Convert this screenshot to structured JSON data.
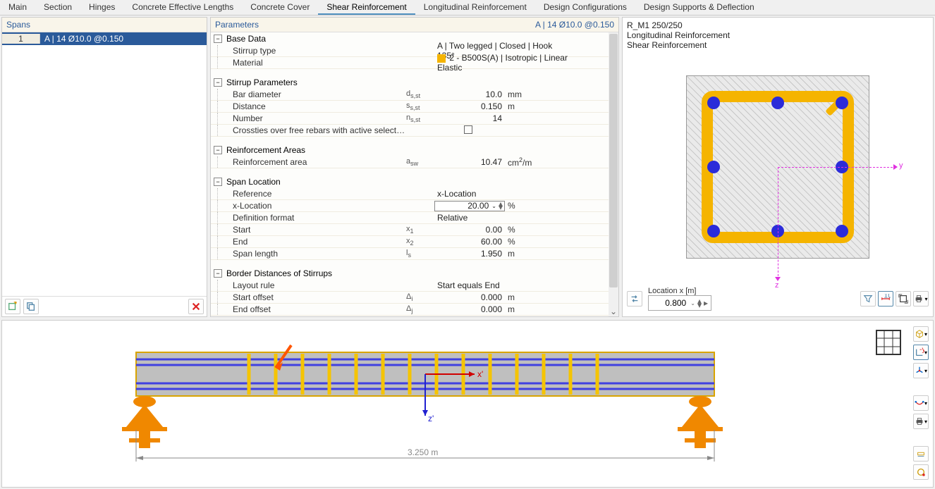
{
  "tabs": [
    "Main",
    "Section",
    "Hinges",
    "Concrete Effective Lengths",
    "Concrete Cover",
    "Shear Reinforcement",
    "Longitudinal Reinforcement",
    "Design Configurations",
    "Design Supports & Deflection"
  ],
  "active_tab": 5,
  "spans": {
    "title": "Spans",
    "items": [
      {
        "no": "1",
        "text": "A | 14 Ø10.0 @0.150"
      }
    ]
  },
  "params": {
    "title": "Parameters",
    "header_right": "A | 14 Ø10.0 @0.150",
    "groups": [
      {
        "name": "Base Data",
        "rows": [
          {
            "label": "Stirrup type",
            "value": "A | Two legged | Closed | Hook 135°"
          },
          {
            "label": "Material",
            "swatch": "#f5b400",
            "value": "2 - B500S(A) | Isotropic | Linear Elastic"
          }
        ]
      },
      {
        "name": "Stirrup Parameters",
        "rows": [
          {
            "label": "Bar diameter",
            "symbol_html": "d<sub>s,st</sub>",
            "value": "10.0",
            "unit": "mm"
          },
          {
            "label": "Distance",
            "symbol_html": "s<sub>s,st</sub>",
            "value": "0.150",
            "unit": "m"
          },
          {
            "label": "Number",
            "symbol_html": "n<sub>s,st</sub>",
            "value": "14"
          },
          {
            "label": "Crossties over free rebars with active selection…",
            "checkbox": true
          }
        ]
      },
      {
        "name": "Reinforcement Areas",
        "rows": [
          {
            "label": "Reinforcement area",
            "symbol_html": "a<sub>sw</sub>",
            "value": "10.47",
            "unit_html": "cm<sup>2</sup>/m"
          }
        ]
      },
      {
        "name": "Span Location",
        "rows": [
          {
            "label": "Reference",
            "value": "x-Location"
          },
          {
            "label": "x-Location",
            "input": true,
            "value": "20.00",
            "unit": "%"
          },
          {
            "label": "Definition format",
            "value": "Relative"
          },
          {
            "label": "Start",
            "symbol_html": "x<sub>1</sub>",
            "value": "0.00",
            "unit": "%"
          },
          {
            "label": "End",
            "symbol_html": "x<sub>2</sub>",
            "value": "60.00",
            "unit": "%"
          },
          {
            "label": "Span length",
            "symbol_html": "l<sub>s</sub>",
            "value": "1.950",
            "unit": "m"
          }
        ]
      },
      {
        "name": "Border Distances of Stirrups",
        "rows": [
          {
            "label": "Layout rule",
            "value": "Start equals End"
          },
          {
            "label": "Start offset",
            "symbol_html": "Δ<sub>i</sub>",
            "value": "0.000",
            "unit": "m"
          },
          {
            "label": "End offset",
            "symbol_html": "Δ<sub>j</sub>",
            "value": "0.000",
            "unit": "m"
          }
        ]
      }
    ]
  },
  "cross_section": {
    "name": "R_M1 250/250",
    "lines": [
      "Longitudinal Reinforcement",
      "Shear Reinforcement"
    ],
    "location_label": "Location x [m]",
    "location_value": "0.800",
    "axis_y": "y",
    "axis_z": "z"
  },
  "beam": {
    "len_label": "3.250 m",
    "axis_x": "x'",
    "axis_z": "z'"
  },
  "colors": {
    "accent": "#2a5a9a",
    "stirrup": "#f5b400",
    "rebar": "#2b2bd9",
    "support": "#f08800"
  },
  "icons": {
    "new": "new-config-icon",
    "copy": "copy-config-icon",
    "delete": "delete-icon",
    "swap": "swap-icon",
    "filter": "filter-icon",
    "measure": "dimension-icon",
    "fit": "zoom-fit-icon",
    "print": "print-icon"
  }
}
